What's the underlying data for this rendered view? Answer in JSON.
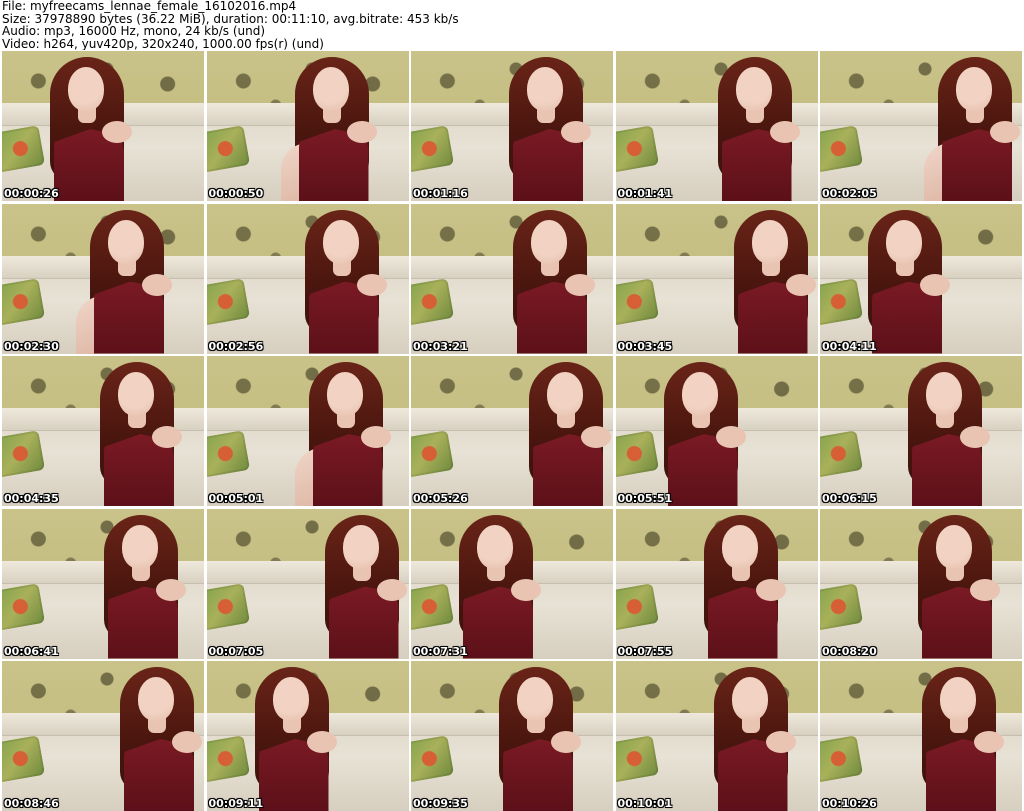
{
  "header": {
    "line1": "File: myfreecams_lennae_female_16102016.mp4",
    "line2": "Size: 37978890 bytes (36.22 MiB), duration: 00:11:10, avg.bitrate: 453 kb/s",
    "line3": "Audio: mp3, 16000 Hz, mono, 24 kb/s (und)",
    "line4": "Video: h264, yuv420p, 320x240, 1000.00 fps(r) (und)"
  },
  "thumbnails": [
    {
      "timestamp": "00:00:26"
    },
    {
      "timestamp": "00:00:50"
    },
    {
      "timestamp": "00:01:16"
    },
    {
      "timestamp": "00:01:41"
    },
    {
      "timestamp": "00:02:05"
    },
    {
      "timestamp": "00:02:30"
    },
    {
      "timestamp": "00:02:56"
    },
    {
      "timestamp": "00:03:21"
    },
    {
      "timestamp": "00:03:45"
    },
    {
      "timestamp": "00:04:11"
    },
    {
      "timestamp": "00:04:35"
    },
    {
      "timestamp": "00:05:01"
    },
    {
      "timestamp": "00:05:26"
    },
    {
      "timestamp": "00:05:51"
    },
    {
      "timestamp": "00:06:15"
    },
    {
      "timestamp": "00:06:41"
    },
    {
      "timestamp": "00:07:05"
    },
    {
      "timestamp": "00:07:31"
    },
    {
      "timestamp": "00:07:55"
    },
    {
      "timestamp": "00:08:20"
    },
    {
      "timestamp": "00:08:46"
    },
    {
      "timestamp": "00:09:11"
    },
    {
      "timestamp": "00:09:35"
    },
    {
      "timestamp": "00:10:01"
    },
    {
      "timestamp": "00:10:26"
    }
  ]
}
